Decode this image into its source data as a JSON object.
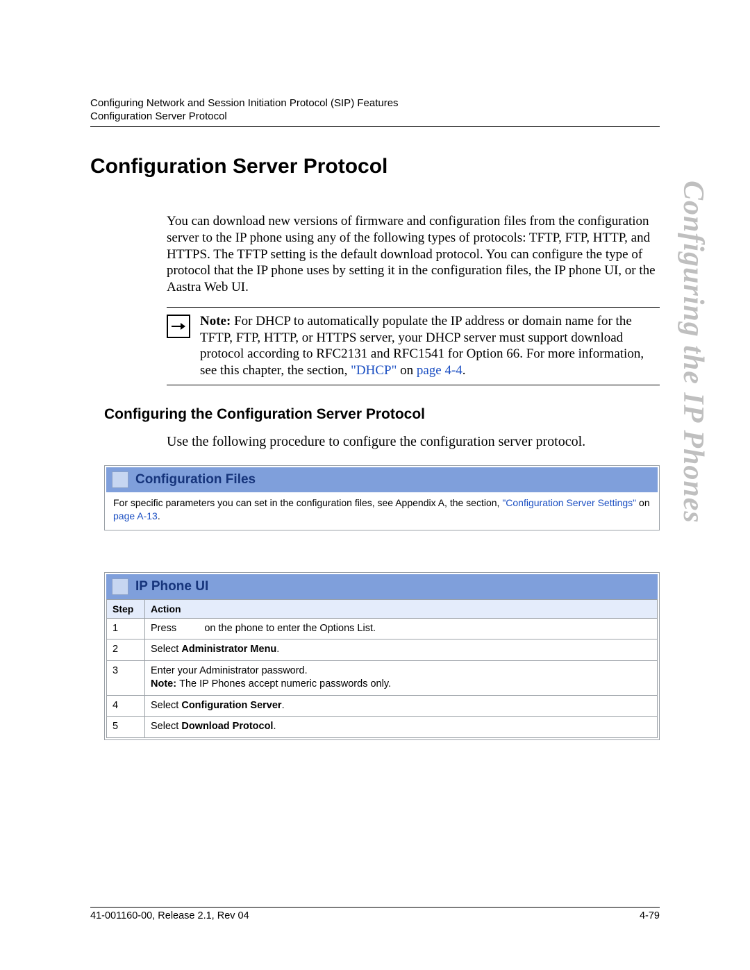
{
  "header": {
    "line1": "Configuring Network and Session Initiation Protocol (SIP) Features",
    "line2": "Configuration Server Protocol"
  },
  "sideText": "Configuring the IP Phones",
  "title": "Configuration Server Protocol",
  "intro": "You can download new versions of firmware and configuration files from the configuration server to the IP phone using any of the following types of protocols: TFTP, FTP, HTTP, and HTTPS. The TFTP setting is the default download protocol. You can configure the type of protocol that the IP phone uses by setting it in the configuration files, the IP phone UI, or the Aastra Web UI.",
  "note": {
    "label": "Note:",
    "text1": " For DHCP to automatically populate the IP address or domain name for the TFTP, FTP, HTTP, or HTTPS server, your DHCP server must support download protocol according to RFC2131 and RFC1541 for Option 66. For more information, see this chapter, the section, ",
    "link1": "\"DHCP\"",
    "text2": " on ",
    "link2": "page 4-4",
    "text3": "."
  },
  "subheading": "Configuring the Configuration Server Protocol",
  "procText": "Use the following procedure to configure the configuration server protocol.",
  "configFilesPanel": {
    "title": "Configuration Files",
    "bodyPrefix": "For specific parameters you can set in the configuration files, see Appendix A, the section, ",
    "link1": "\"Configuration Server Settings\"",
    "mid": " on ",
    "link2": "page A-13",
    "suffix": "."
  },
  "ipPhonePanel": {
    "title": "IP Phone UI",
    "columns": {
      "step": "Step",
      "action": "Action"
    },
    "rows": [
      {
        "step": "1",
        "pre": "Press ",
        "mid": "",
        "post": " on the phone to enter the Options List."
      },
      {
        "step": "2",
        "pre": "Select ",
        "bold": "Administrator Menu",
        "post": "."
      },
      {
        "step": "3",
        "pre": "Enter your Administrator password.",
        "br": true,
        "boldPre": "Note: ",
        "post2": "The IP Phones accept numeric passwords only."
      },
      {
        "step": "4",
        "pre": "Select ",
        "bold": "Configuration Server",
        "post": "."
      },
      {
        "step": "5",
        "pre": "Select ",
        "bold": "Download Protocol",
        "post": "."
      }
    ]
  },
  "footer": {
    "left": "41-001160-00, Release 2.1, Rev 04",
    "right": "4-79"
  }
}
